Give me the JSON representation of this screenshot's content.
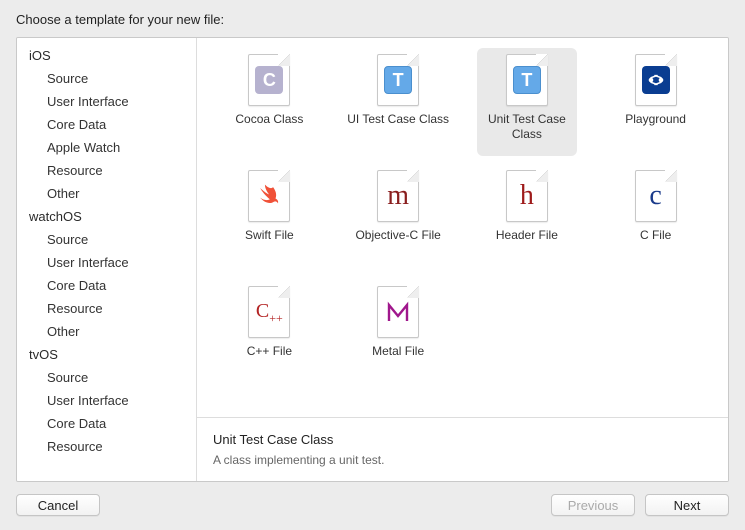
{
  "header": {
    "title": "Choose a template for your new file:"
  },
  "sidebar": {
    "groups": [
      {
        "label": "iOS",
        "items": [
          "Source",
          "User Interface",
          "Core Data",
          "Apple Watch",
          "Resource",
          "Other"
        ]
      },
      {
        "label": "watchOS",
        "items": [
          "Source",
          "User Interface",
          "Core Data",
          "Resource",
          "Other"
        ]
      },
      {
        "label": "tvOS",
        "items": [
          "Source",
          "User Interface",
          "Core Data",
          "Resource"
        ]
      }
    ]
  },
  "templates": [
    {
      "label": "Cocoa Class",
      "icon": "c-block"
    },
    {
      "label": "UI Test Case Class",
      "icon": "t-block"
    },
    {
      "label": "Unit Test Case Class",
      "icon": "t-block",
      "selected": true
    },
    {
      "label": "Playground",
      "icon": "play-block"
    },
    {
      "label": "Swift File",
      "icon": "swift"
    },
    {
      "label": "Objective-C File",
      "icon": "m"
    },
    {
      "label": "Header File",
      "icon": "h"
    },
    {
      "label": "C File",
      "icon": "c"
    },
    {
      "label": "C++ File",
      "icon": "cpp"
    },
    {
      "label": "Metal File",
      "icon": "metal"
    }
  ],
  "detail": {
    "title": "Unit Test Case Class",
    "description": "A class implementing a unit test."
  },
  "footer": {
    "cancel": "Cancel",
    "previous": "Previous",
    "next": "Next"
  }
}
